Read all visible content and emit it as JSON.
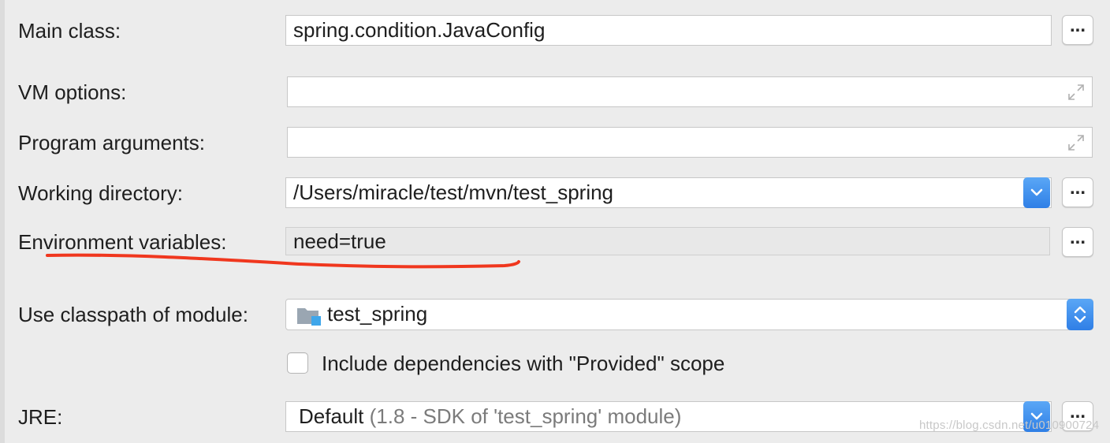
{
  "form": {
    "main_class": {
      "label": "Main class:",
      "value": "spring.condition.JavaConfig",
      "browse_label": "..."
    },
    "vm_options": {
      "label": "VM options:",
      "value": ""
    },
    "program_arguments": {
      "label": "Program arguments:",
      "value": ""
    },
    "working_directory": {
      "label": "Working directory:",
      "value": "/Users/miracle/test/mvn/test_spring",
      "browse_label": "..."
    },
    "environment_variables": {
      "label": "Environment variables:",
      "value": "need=true",
      "browse_label": "..."
    },
    "classpath_module": {
      "label": "Use classpath of module:",
      "value": "test_spring"
    },
    "include_provided": {
      "label": "Include dependencies with \"Provided\" scope",
      "checked": false
    },
    "jre": {
      "label": "JRE:",
      "value": "Default",
      "detail": "(1.8 - SDK of 'test_spring' module)",
      "browse_label": "..."
    }
  },
  "watermark": "https://blog.csdn.net/u010900724",
  "colors": {
    "accent": "#3d8ef0",
    "annotation": "#f0371e",
    "background": "#ececec"
  },
  "icons": [
    "expand-icon",
    "chevron-down-icon",
    "chevron-up-down-icon",
    "folder-module-icon",
    "browse-ellipsis-icon"
  ]
}
